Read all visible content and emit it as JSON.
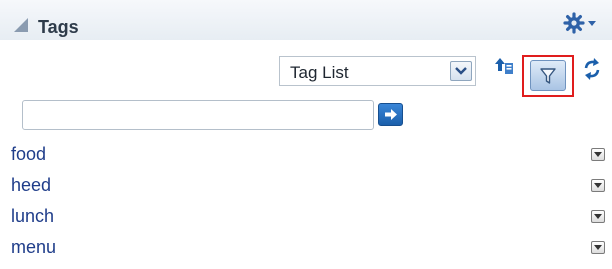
{
  "panel": {
    "title": "Tags",
    "icons": {
      "collapse": "collapse-triangle-icon",
      "settings": "gear-icon",
      "settings_menu": "chevron-down-icon"
    }
  },
  "toolbar": {
    "view_select": {
      "selected": "Tag List"
    },
    "icons": [
      "upload-tags-icon",
      "filter-icon",
      "sync-icon"
    ],
    "accent_color": "#3a86d8",
    "highlight_color": "#e01d1d"
  },
  "search": {
    "value": "",
    "placeholder": ""
  },
  "tags": [
    {
      "label": "food"
    },
    {
      "label": "heed"
    },
    {
      "label": "lunch"
    },
    {
      "label": "menu"
    }
  ],
  "colors": {
    "link": "#1f3d8a",
    "header_bg": "#e7edf3"
  }
}
